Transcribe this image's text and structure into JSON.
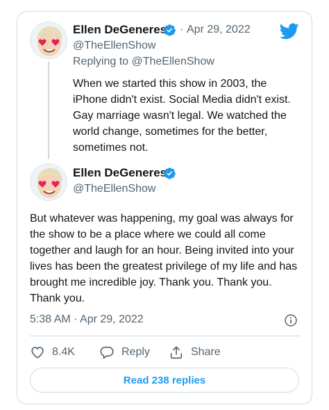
{
  "colors": {
    "twitter_blue": "#1d9bf0",
    "text": "#0f1419",
    "muted": "#536471",
    "border": "#cfd9de"
  },
  "parent_tweet": {
    "author_name": "Ellen DeGeneres",
    "author_handle": "@TheEllenShow",
    "separator": "·",
    "date": "Apr 29, 2022",
    "replying_to": "Replying to @TheEllenShow",
    "text": "When we started this show in 2003, the iPhone didn't exist. Social Media didn't exist. Gay marriage wasn't legal. We watched the world change, sometimes for the better, sometimes not."
  },
  "main_tweet": {
    "author_name": "Ellen DeGeneres",
    "author_handle": "@TheEllenShow",
    "text": "But whatever was happening, my goal was always for the show to be a place where we could all come together and laugh for an hour.  Being invited into your lives has been the greatest privilege of my life and has brought me incredible joy. Thank you. Thank you. Thank you.",
    "timestamp": "5:38 AM · Apr 29, 2022"
  },
  "actions": {
    "like_count": "8.4K",
    "reply_label": "Reply",
    "share_label": "Share"
  },
  "read_replies_label": "Read 238 replies",
  "icons": [
    "twitter-bird-icon",
    "verified-icon",
    "info-icon",
    "heart-icon",
    "reply-bubble-icon",
    "share-icon"
  ]
}
